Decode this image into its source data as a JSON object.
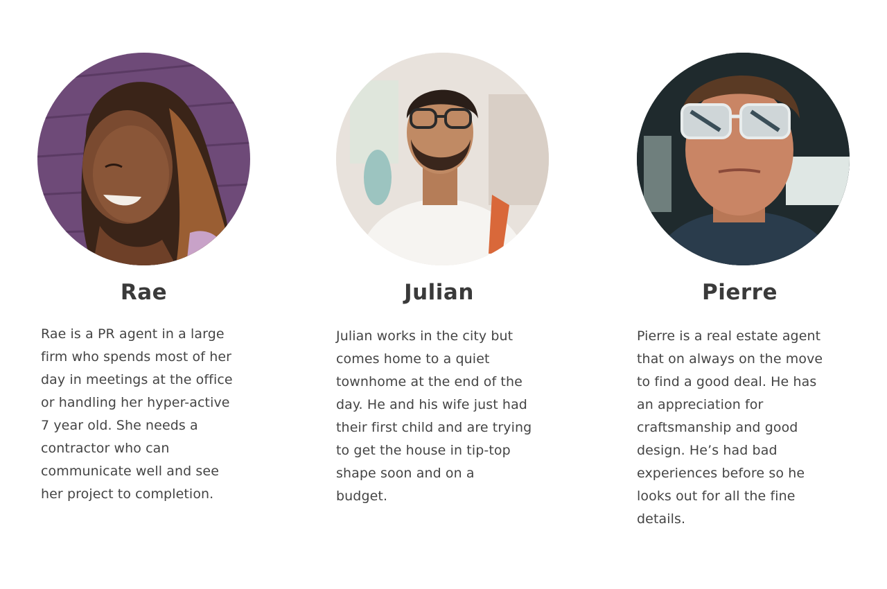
{
  "personas": [
    {
      "name": "Rae",
      "photo_alt": "rae-photo",
      "bio_lines": [
        "Rae is a PR agent in a large",
        "firm who spends most of her",
        "day in meetings at the office",
        "or handling her hyper-active",
        "7 year old. She needs a",
        "contractor who can",
        "communicate well and see",
        "her project to completion."
      ]
    },
    {
      "name": "Julian",
      "photo_alt": "julian-photo",
      "bio_lines": [
        "Julian works in the city but",
        "comes home to a quiet",
        "townhome at the end of the",
        "day. He and his wife just had",
        "their first child and are trying",
        "to get the house in tip-top",
        "shape soon and on a",
        "budget."
      ]
    },
    {
      "name": "Pierre",
      "photo_alt": "pierre-photo",
      "bio_lines": [
        "Pierre is a real estate agent",
        "that on always on the move",
        "to find a good deal. He has",
        "an appreciation for",
        "craftsmanship and good",
        "design. He’s had bad",
        "experiences before so he",
        "looks out for all the fine",
        "details."
      ]
    }
  ],
  "colors": {
    "text": "#3a3a3a",
    "rae_bg": "#6e4a78",
    "julian_bg": "#efe9e4",
    "pierre_bg": "#2e3a3e"
  }
}
